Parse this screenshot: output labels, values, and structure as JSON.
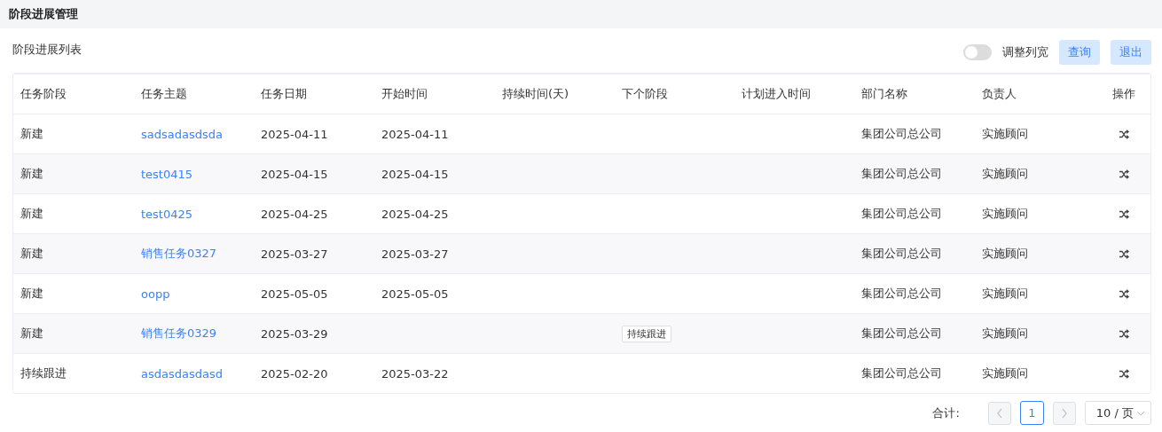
{
  "page_title": "阶段进展管理",
  "list_title": "阶段进展列表",
  "toolbar": {
    "toggle": {
      "label": "调整列宽",
      "on": false
    },
    "buttons": [
      "查询",
      "退出"
    ]
  },
  "table": {
    "columns": [
      "任务阶段",
      "任务主题",
      "任务日期",
      "开始时间",
      "持续时间(天)",
      "下个阶段",
      "计划进入时间",
      "部门名称",
      "负责人",
      "操作"
    ],
    "rows": [
      {
        "stage": "新建",
        "subject": "sadsadasdsda",
        "date": "2025-04-11",
        "start": "2025-04-11",
        "department": "集团公司总公司",
        "owner": "实施顾问"
      },
      {
        "stage": "新建",
        "subject": "test0415",
        "date": "2025-04-15",
        "start": "2025-04-15",
        "department": "集团公司总公司",
        "owner": "实施顾问"
      },
      {
        "stage": "新建",
        "subject": "test0425",
        "date": "2025-04-25",
        "start": "2025-04-25",
        "department": "集团公司总公司",
        "owner": "实施顾问"
      },
      {
        "stage": "新建",
        "subject": "销售任务0327",
        "date": "2025-03-27",
        "start": "2025-03-27",
        "department": "集团公司总公司",
        "owner": "实施顾问"
      },
      {
        "stage": "新建",
        "subject": "oopp",
        "date": "2025-05-05",
        "start": "2025-05-05",
        "department": "集团公司总公司",
        "owner": "实施顾问"
      },
      {
        "stage": "新建",
        "subject": "销售任务0329",
        "date": "2025-03-29",
        "next_stage": "持续跟进",
        "department": "集团公司总公司",
        "owner": "实施顾问"
      },
      {
        "stage": "持续跟进",
        "subject": "asdasdasdasd",
        "date": "2025-02-20",
        "start": "2025-03-22",
        "department": "集团公司总公司",
        "owner": "实施顾问"
      }
    ]
  },
  "pagination": {
    "total_label": "合计:",
    "pages": [
      {
        "label": "1",
        "selected": true
      }
    ],
    "page_size": "10 / 页"
  }
}
